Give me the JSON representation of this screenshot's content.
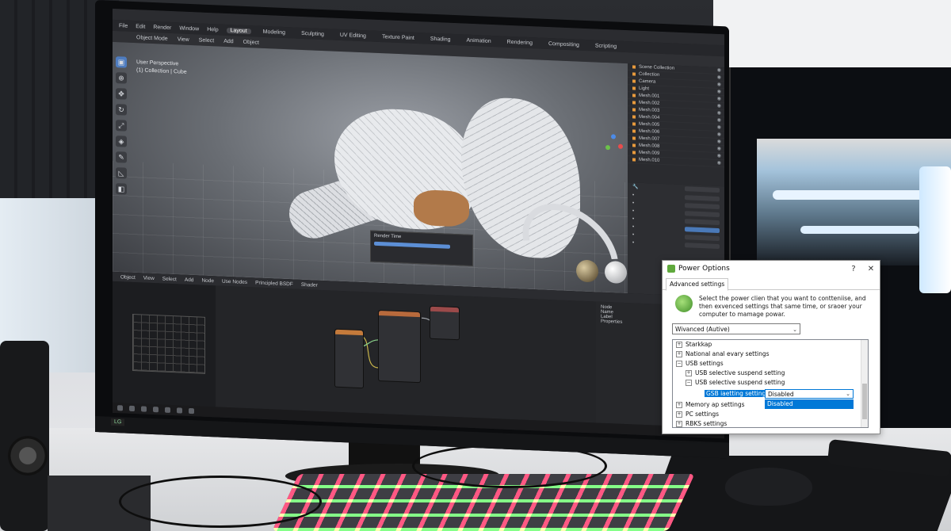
{
  "blender": {
    "menus": [
      "File",
      "Edit",
      "Render",
      "Window",
      "Help"
    ],
    "workspaces": [
      "Layout",
      "Modeling",
      "Sculpting",
      "UV Editing",
      "Texture Paint",
      "Shading",
      "Animation",
      "Rendering",
      "Compositing",
      "Scripting"
    ],
    "active_workspace": "Layout",
    "viewport_header": [
      "Object Mode",
      "View",
      "Select",
      "Add",
      "Object"
    ],
    "viewport_overlay": [
      "User Perspective",
      "(1) Collection | Cube"
    ],
    "popup_title": "Render Time",
    "outliner_rows": [
      "Scene Collection",
      "Collection",
      "Camera",
      "Light",
      "Mesh.001",
      "Mesh.002",
      "Mesh.003",
      "Mesh.004",
      "Mesh.005",
      "Mesh.006",
      "Mesh.007",
      "Mesh.008",
      "Mesh.009",
      "Mesh.010"
    ],
    "node_header": [
      "Object",
      "View",
      "Select",
      "Add",
      "Node",
      "Use Nodes"
    ],
    "node_breadcrumb": [
      "Principled BSDF",
      "Shader"
    ],
    "node_side": [
      "Node",
      "Name",
      "Label",
      "Properties"
    ],
    "bezel_tag": "LG"
  },
  "power_options": {
    "title": "Power Options",
    "help_glyph": "?",
    "close_glyph": "✕",
    "tab": "Advanced settings",
    "description": "Select the power clien that you want to contteniise, and then exvenced settings that same time, or sraoer your computer to mamage powar.",
    "plan_selected": "Wivanced (Autive)",
    "tree": [
      {
        "label": "Starkkap",
        "expander": "+",
        "level": 0
      },
      {
        "label": "National anal evary settings",
        "expander": "+",
        "level": 0
      },
      {
        "label": "USB settings",
        "expander": "−",
        "level": 0
      },
      {
        "label": "USB selective suspend setting",
        "expander": "+",
        "level": 1
      },
      {
        "label": "USB selective suspend setting",
        "expander": "−",
        "level": 1
      },
      {
        "label": "Memory ap settings",
        "expander": "+",
        "level": 0
      },
      {
        "label": "PC settings",
        "expander": "+",
        "level": 0
      },
      {
        "label": "RBKS settings",
        "expander": "+",
        "level": 0
      }
    ],
    "setting_label": "GSB iaetting setting:",
    "setting_value": "Disabled",
    "dropdown_option": "Disabled"
  },
  "colors": {
    "accent": "#0078d7",
    "blender_active": "#4e7cbf",
    "mech_core": "#b27a4a"
  }
}
